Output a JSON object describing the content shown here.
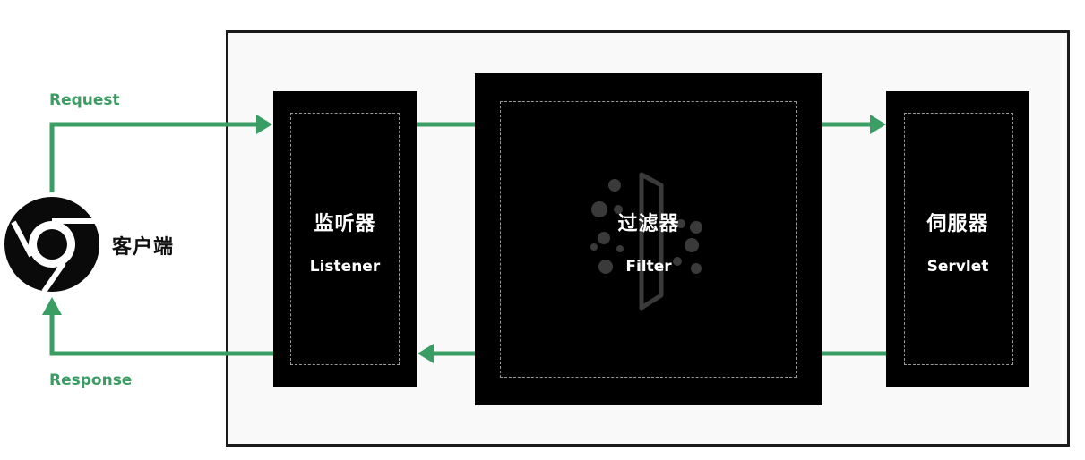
{
  "client": {
    "label": "客户端",
    "icon": "chrome-browser-icon"
  },
  "flows": {
    "request_label": "Request",
    "response_label": "Response"
  },
  "blocks": {
    "listener": {
      "cn": "监听器",
      "en": "Listener"
    },
    "filter": {
      "cn": "过滤器",
      "en": "Filter",
      "icon": "filter-funnel-icon"
    },
    "servlet": {
      "cn": "伺服器",
      "en": "Servlet"
    }
  },
  "colors": {
    "arrow": "#3a9d64",
    "block": "#000000",
    "container_border": "#1a1a1a",
    "container_fill": "#f9f9f9"
  }
}
